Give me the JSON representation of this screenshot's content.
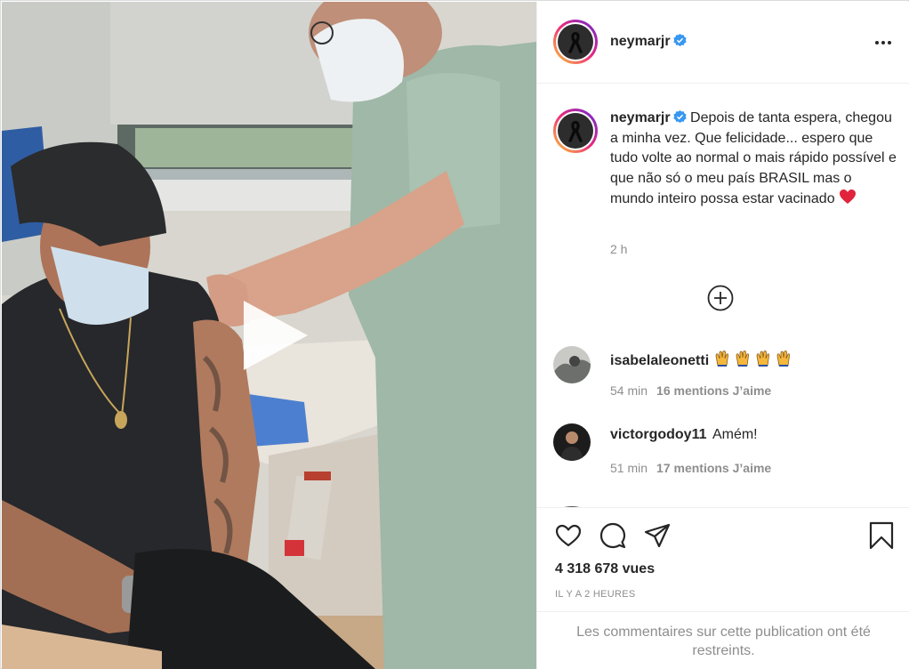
{
  "post": {
    "author": "neymarjr",
    "verified": true
  },
  "header": {
    "username": "neymarjr",
    "more_icon": "more-horizontal-icon"
  },
  "caption": {
    "username": "neymarjr",
    "text": "Depois de tanta espera, chegou a minha vez. Que felicidade... espero que tudo volte ao normal o mais rápido possível e que não só o meu país BRASIL mas o mundo inteiro possa estar vacinado",
    "emoji": "heart",
    "time": "2 h"
  },
  "load_more_icon": "plus-circle-icon",
  "comments": [
    {
      "username": "isabelaleonetti",
      "text": "",
      "emoji": "raised-hands x4",
      "time": "54 min",
      "likes": "16 mentions J’aime"
    },
    {
      "username": "victorgodoy11",
      "text": "Amém!",
      "time": "51 min",
      "likes": "17 mentions J’aime"
    }
  ],
  "actions": {
    "icons": [
      "heart-icon",
      "comment-icon",
      "share-icon",
      "bookmark-icon"
    ],
    "views": "4 318 678 vues",
    "timestamp": "IL Y A 2 HEURES",
    "restricted": "Les commentaires sur cette publication ont été restreints."
  },
  "colors": {
    "text": "#262626",
    "secondary": "#8e8e8e",
    "verified": "#3897f0",
    "border": "#efefef",
    "heart": "#ed4956"
  },
  "media": {
    "type": "video",
    "play_icon": "play-icon"
  }
}
